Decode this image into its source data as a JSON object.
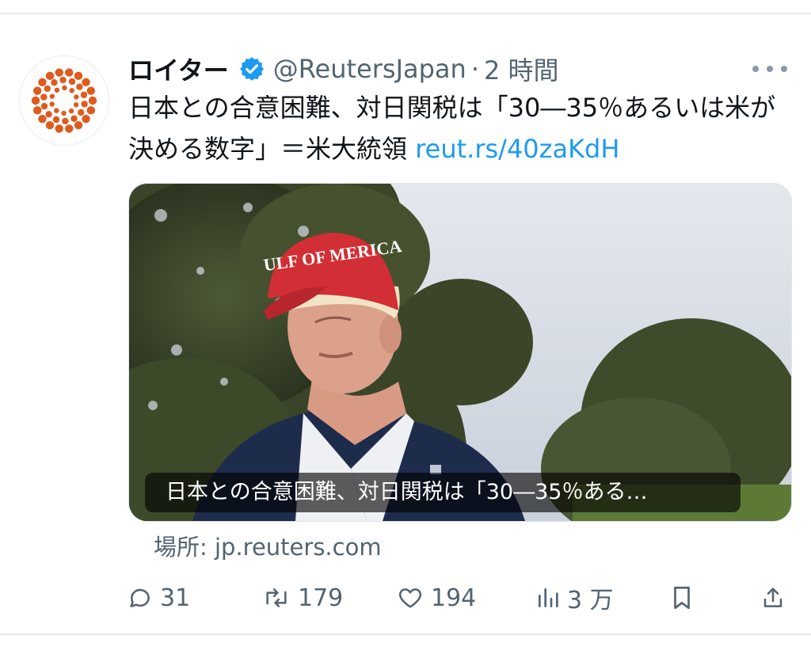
{
  "account": {
    "name": "ロイター",
    "handle": "@ReutersJapan",
    "separator": "·",
    "time": "2 時間"
  },
  "tweet": {
    "text": "日本との合意困難、対日関税は「30―35％あるいは米が決める数字」＝米大統領 ",
    "link": "reut.rs/40zaKdH"
  },
  "card": {
    "caption": "日本との合意困難、対日関税は「30―35％ある…",
    "cap_text": "ULF OF MERICA"
  },
  "source": {
    "label": "場所: jp.reuters.com"
  },
  "actions": {
    "replies": "31",
    "retweets": "179",
    "likes": "194",
    "views": "3 万"
  },
  "icons": {
    "avatar": "reuters-logo",
    "verified": "verified-badge-icon",
    "more": "more-dots-icon",
    "reply": "reply-icon",
    "retweet": "retweet-icon",
    "like": "heart-icon",
    "views": "views-chart-icon",
    "bookmark": "bookmark-icon",
    "share": "share-icon"
  },
  "colors": {
    "link": "#1d9bf0",
    "verified": "#1d9bf0",
    "logo": "#e05a1e",
    "secondary_text": "#536471"
  }
}
